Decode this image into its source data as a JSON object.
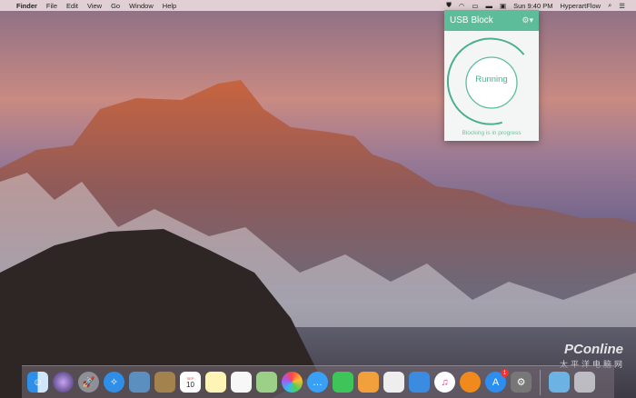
{
  "menubar": {
    "apple": "",
    "app": "Finder",
    "items": [
      "File",
      "Edit",
      "View",
      "Go",
      "Window",
      "Help"
    ],
    "clock": "Sun 9:40 PM",
    "user": "HyperartFlow"
  },
  "popup": {
    "title": "USB Block",
    "state": "Running",
    "status": "Blocking is in progress",
    "accent": "#5dbd9a"
  },
  "dock": {
    "calendar_month": "SEP",
    "calendar_day": "10",
    "appstore_badge": "1"
  },
  "watermark": {
    "brand": "PConline",
    "sub": "太平洋电脑网"
  }
}
